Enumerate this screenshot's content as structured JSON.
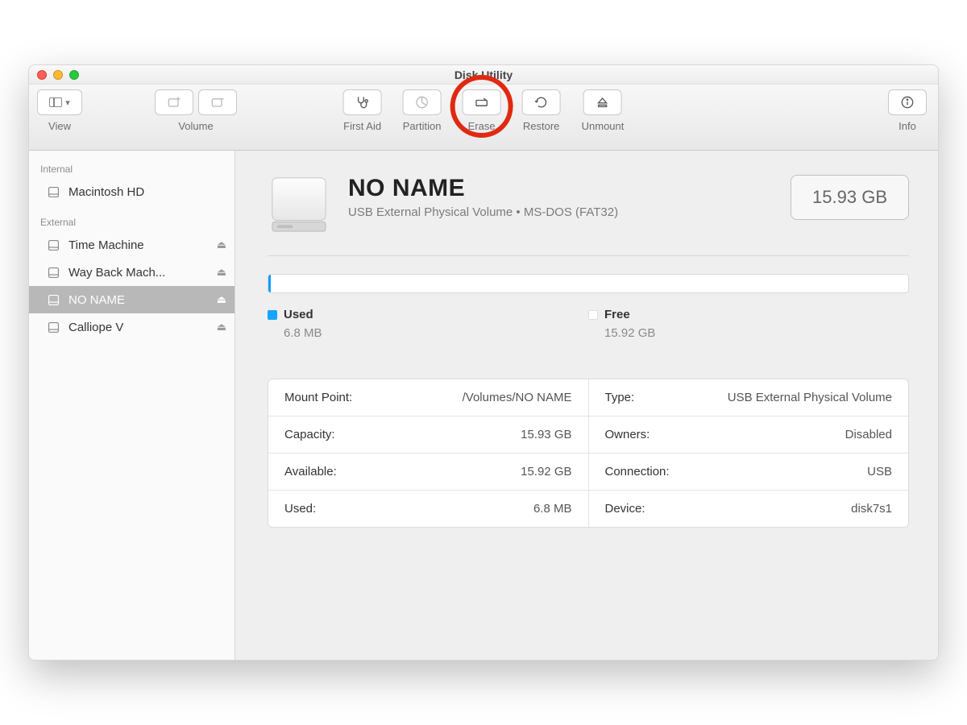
{
  "window": {
    "title": "Disk Utility"
  },
  "toolbar": {
    "view": "View",
    "volume": "Volume",
    "first_aid": "First Aid",
    "partition": "Partition",
    "erase": "Erase",
    "restore": "Restore",
    "unmount": "Unmount",
    "info": "Info"
  },
  "sidebar": {
    "sections": {
      "internal": "Internal",
      "external": "External"
    },
    "internal": [
      {
        "label": "Macintosh HD",
        "ejectable": false
      }
    ],
    "external": [
      {
        "label": "Time Machine",
        "ejectable": true
      },
      {
        "label": "Way Back Mach...",
        "ejectable": true
      },
      {
        "label": "NO NAME",
        "ejectable": true,
        "selected": true
      },
      {
        "label": "Calliope V",
        "ejectable": true
      }
    ]
  },
  "volume": {
    "name": "NO NAME",
    "subtitle": "USB External Physical Volume • MS-DOS (FAT32)",
    "capacity_badge": "15.93 GB"
  },
  "usage": {
    "used_label": "Used",
    "used_value": "6.8 MB",
    "free_label": "Free",
    "free_value": "15.92 GB"
  },
  "info_left": [
    {
      "k": "Mount Point:",
      "v": "/Volumes/NO NAME"
    },
    {
      "k": "Capacity:",
      "v": "15.93 GB"
    },
    {
      "k": "Available:",
      "v": "15.92 GB"
    },
    {
      "k": "Used:",
      "v": "6.8 MB"
    }
  ],
  "info_right": [
    {
      "k": "Type:",
      "v": "USB External Physical Volume"
    },
    {
      "k": "Owners:",
      "v": "Disabled"
    },
    {
      "k": "Connection:",
      "v": "USB"
    },
    {
      "k": "Device:",
      "v": "disk7s1"
    }
  ]
}
